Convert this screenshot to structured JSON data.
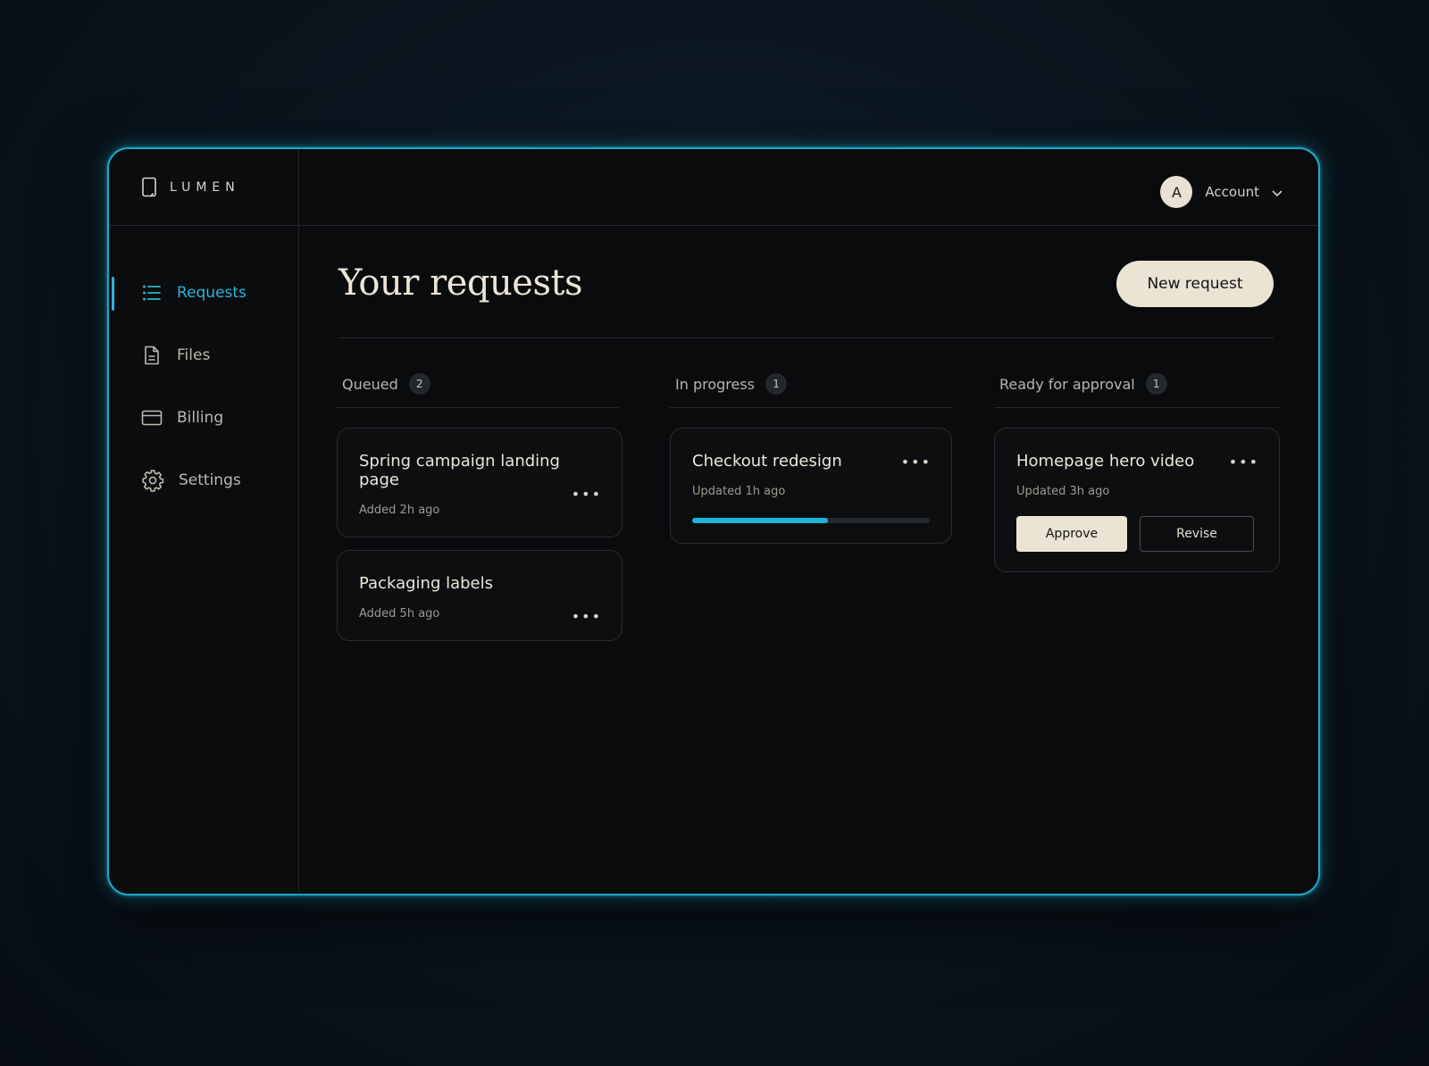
{
  "brand": {
    "name": "LUMEN"
  },
  "colors": {
    "accent": "#29b6d6",
    "button_light": "#ebe3d4",
    "background": "#0a0b0d"
  },
  "sidebar": {
    "items": [
      {
        "label": "Requests",
        "icon": "list-icon",
        "active": true
      },
      {
        "label": "Files",
        "icon": "file-icon",
        "active": false
      },
      {
        "label": "Billing",
        "icon": "card-icon",
        "active": false
      },
      {
        "label": "Settings",
        "icon": "gear-icon",
        "active": false
      }
    ]
  },
  "header": {
    "avatar_initial": "A",
    "account_label": "Account"
  },
  "main": {
    "title": "Your requests",
    "new_request_label": "New request",
    "columns": [
      {
        "label": "Queued",
        "count": "2",
        "cards": [
          {
            "title": "Spring campaign landing page",
            "meta": "Added 2h ago"
          },
          {
            "title": "Packaging labels",
            "meta": "Added 5h ago"
          }
        ]
      },
      {
        "label": "In progress",
        "count": "1",
        "cards": [
          {
            "title": "Checkout redesign",
            "meta": "Updated 1h ago",
            "progress": 0.57
          }
        ]
      },
      {
        "label": "Ready for approval",
        "count": "1",
        "cards": [
          {
            "title": "Homepage hero video",
            "meta": "Updated 3h ago",
            "approve_label": "Approve",
            "revise_label": "Revise"
          }
        ]
      }
    ]
  }
}
